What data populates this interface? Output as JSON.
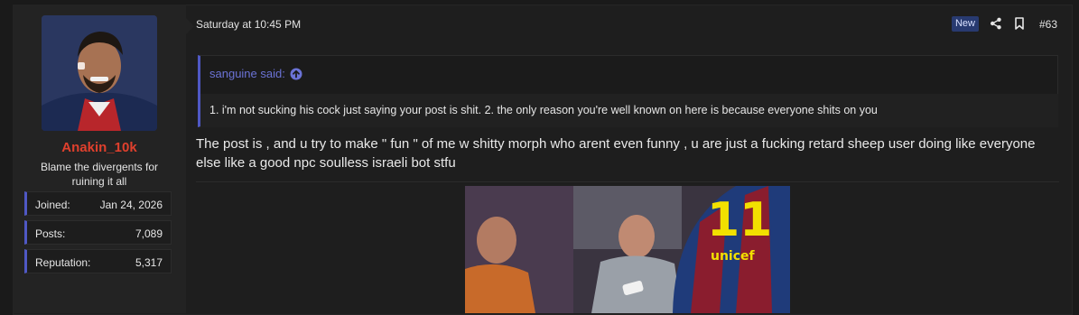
{
  "user": {
    "name": "Anakin_10k",
    "title": "Blame the divergents for ruining it all",
    "stats": [
      {
        "label": "Joined:",
        "value": "Jan 24, 2026"
      },
      {
        "label": "Posts:",
        "value": "7,089"
      },
      {
        "label": "Reputation:",
        "value": "5,317"
      }
    ]
  },
  "post": {
    "date": "Saturday at 10:45 PM",
    "badge": "New",
    "number": "#63",
    "quote": {
      "author": "sanguine said:",
      "text": "1. i'm not sucking his cock just saying your post is shit. 2. the only reason you're well known on here is because everyone shits on you"
    },
    "message": "The post is , and u try to make \" fun \" of me w shitty morph who arent even funny , u are just a fucking retard sheep user doing like everyone else like a good npc soulless israeli bot stfu"
  },
  "icons": {
    "share": "share-icon",
    "bookmark": "bookmark-icon",
    "quote_up": "arrow-up-circle-icon"
  },
  "colors": {
    "accent": "#4f58c4",
    "username": "#e0402d",
    "badge_bg": "#283a70"
  }
}
